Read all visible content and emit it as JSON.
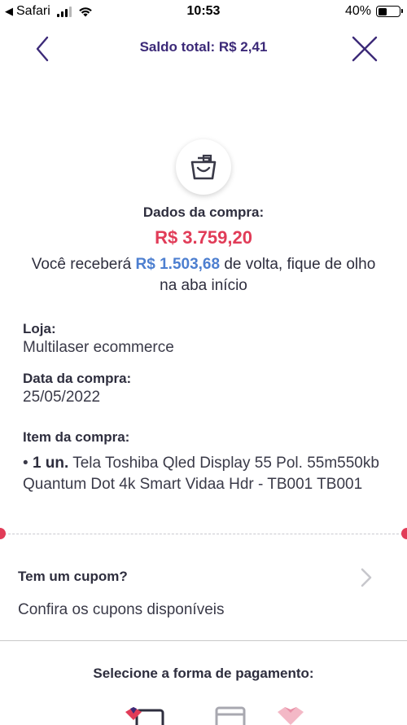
{
  "status_bar": {
    "back_app": "Safari",
    "time": "10:53",
    "battery_percent": "40%",
    "battery_level": 0.4,
    "signal_bars_active": 3,
    "signal_bars_total": 4
  },
  "header": {
    "title": "Saldo total: R$ 2,41",
    "back_icon": "chevron-left-icon",
    "close_icon": "close-icon"
  },
  "purchase": {
    "icon": "shopping-bag-icon",
    "section_title": "Dados da compra:",
    "total": "R$ 3.759,20",
    "cashback_prefix": "Você receberá",
    "cashback_amount": "R$ 1.503,68",
    "cashback_suffix": "de volta, fique de olho na aba início",
    "store_label": "Loja:",
    "store_value": "Multilaser ecommerce",
    "date_label": "Data da compra:",
    "date_value": "25/05/2022",
    "item_label": "Item da compra:",
    "item_bullet": "•",
    "item_qty": "1 un.",
    "item_description": "Tela Toshiba Qled Display 55 Pol. 55m550kb Quantum Dot 4k Smart Vidaa Hdr - TB001 TB001"
  },
  "coupon": {
    "title": "Tem um cupom?",
    "subtitle": "Confira os cupons disponíveis",
    "icon": "chevron-right-icon"
  },
  "payment": {
    "title": "Selecione a forma de pagamento:",
    "options_icons": [
      "heart-card-icon",
      "card-icon",
      "heart-icon"
    ]
  },
  "colors": {
    "accent_purple": "#3c2a78",
    "price_red": "#e13c58",
    "cashback_blue": "#4d7fd0"
  }
}
